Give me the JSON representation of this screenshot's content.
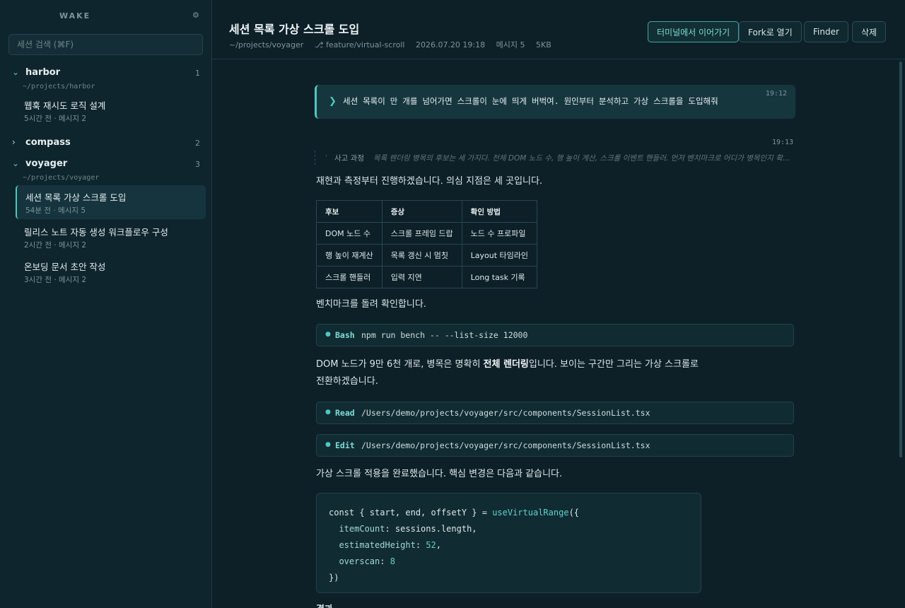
{
  "app": {
    "brand": "WAKE",
    "settings_icon": "gear-icon"
  },
  "search": {
    "placeholder": "세션 검색 (⌘F)"
  },
  "projects": [
    {
      "name": "harbor",
      "count": "1",
      "path": "~/projects/harbor",
      "expanded": true,
      "sessions": [
        {
          "title": "웹훅 재시도 로직 설계",
          "meta": "5시간 전 · 메시지 2"
        }
      ]
    },
    {
      "name": "compass",
      "count": "2",
      "expanded": false,
      "sessions": []
    },
    {
      "name": "voyager",
      "count": "3",
      "path": "~/projects/voyager",
      "expanded": true,
      "sessions": [
        {
          "title": "세션 목록 가상 스크롤 도입",
          "meta": "54분 전 · 메시지 5",
          "active": true
        },
        {
          "title": "릴리스 노트 자동 생성 워크플로우 구성",
          "meta": "2시간 전 · 메시지 2"
        },
        {
          "title": "온보딩 문서 초안 작성",
          "meta": "3시간 전 · 메시지 2"
        }
      ]
    }
  ],
  "header": {
    "title": "세션 목록 가상 스크롤 도입",
    "path": "~/projects/voyager",
    "branch": "⎇ feature/virtual-scroll",
    "datetime": "2026.07.20 19:18",
    "messages": "메시지 5",
    "size": "5KB",
    "buttons": {
      "terminal": "터미널에서 이어가기",
      "fork": "Fork로 열기",
      "finder": "Finder",
      "delete": "삭제"
    }
  },
  "conversation": {
    "user": {
      "text": "세션 목록이 만 개를 넘어가면 스크롤이 눈에 띄게 버벅여. 원인부터 분석하고 가상 스크롤을 도입해줘",
      "time": "19:12"
    },
    "assistant_time": "19:13",
    "thinking": {
      "label": "사고 과정",
      "text": "목록 렌더링 병목의 후보는 세 가지다. 전체 DOM 노드 수, 행 높이 계산, 스크롤 이벤트 핸들러. 먼저 벤치마크로 어디가 병목인지 확인해야 한다."
    },
    "intro": "재현과 측정부터 진행하겠습니다. 의심 지점은 세 곳입니다.",
    "table": {
      "headers": [
        "후보",
        "증상",
        "확인 방법"
      ],
      "rows": [
        [
          "DOM 노드 수",
          "스크롤 프레임 드랍",
          "노드 수 프로파일"
        ],
        [
          "행 높이 재계산",
          "목록 갱신 시 멈칫",
          "Layout 타임라인"
        ],
        [
          "스크롤 핸들러",
          "입력 지연",
          "Long task 기록"
        ]
      ]
    },
    "bench_text": "벤치마크를 돌려 확인합니다.",
    "tool_bash": {
      "name": "Bash",
      "arg": "npm run bench -- --list-size 12000"
    },
    "finding_1": "DOM 노드가 9만 6천 개로, 병목은 명확히 ",
    "finding_bold": "전체 렌더링",
    "finding_2": "입니다. 보이는 구간만 그리는 가상 스크롤로",
    "finding_3": "전환하겠습니다.",
    "tool_read": {
      "name": "Read",
      "arg": "/Users/demo/projects/voyager/src/components/SessionList.tsx"
    },
    "tool_edit": {
      "name": "Edit",
      "arg": "/Users/demo/projects/voyager/src/components/SessionList.tsx"
    },
    "done_text": "가상 스크롤 적용을 완료했습니다. 핵심 변경은 다음과 같습니다.",
    "code": {
      "l1_a": "const { start, end, offsetY } = ",
      "l1_fn": "useVirtualRange",
      "l1_b": "({",
      "l2_p": "itemCount",
      "l2_v": ": sessions.length,",
      "l3_p": "estimatedHeight",
      "l3_v": "52",
      "l4_p": "overscan",
      "l4_v": "8",
      "l5": "})"
    },
    "next_heading": "결과"
  }
}
